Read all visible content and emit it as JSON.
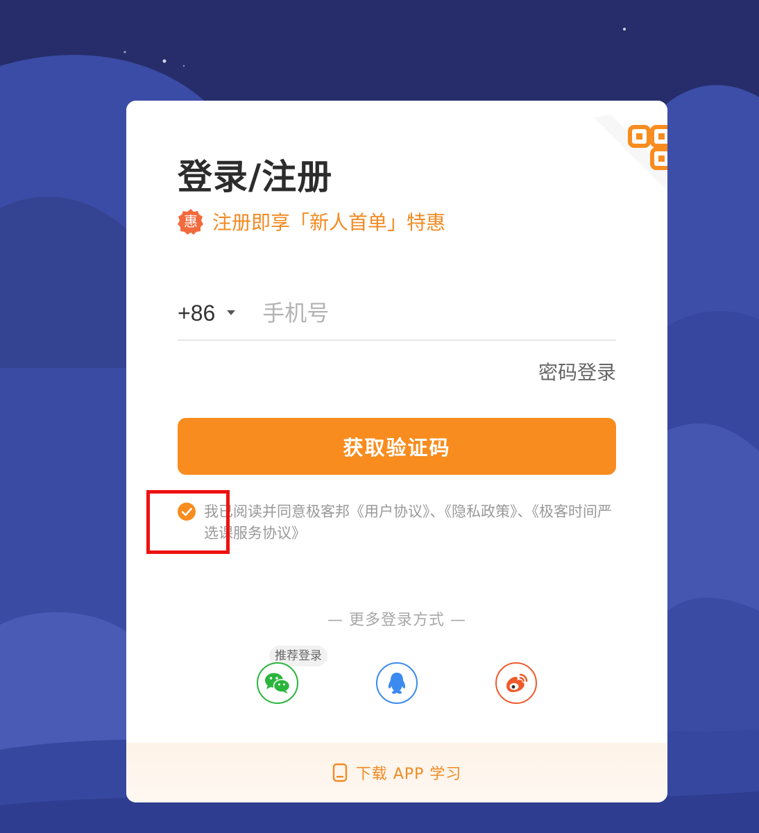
{
  "login": {
    "title": "登录/注册",
    "promo_badge": "惠",
    "promo_text": "注册即享「新人首单」特惠",
    "country_code": "+86",
    "phone_placeholder": "手机号",
    "password_login": "密码登录",
    "get_code_button": "获取验证码",
    "agreement": {
      "prefix": "我已阅读并同意极客邦",
      "user_agreement": "《用户协议》",
      "sep1": "、",
      "privacy_policy": "《隐私政策》",
      "sep2": "、",
      "course_agreement": "《极客时间严选课服务协议》",
      "checked": true
    },
    "more_methods": "— 更多登录方式 —",
    "recommended_badge": "推荐登录",
    "social": [
      {
        "name": "wechat",
        "icon": "wechat-icon",
        "color": "#2ab53b"
      },
      {
        "name": "qq",
        "icon": "qq-icon",
        "color": "#3a8af0"
      },
      {
        "name": "weibo",
        "icon": "weibo-icon",
        "color": "#ee5a2c"
      }
    ],
    "footer_text": "下载 APP 学习"
  },
  "colors": {
    "accent": "#f88c1e",
    "background": "#27306e",
    "highlight": "#ee1111"
  }
}
